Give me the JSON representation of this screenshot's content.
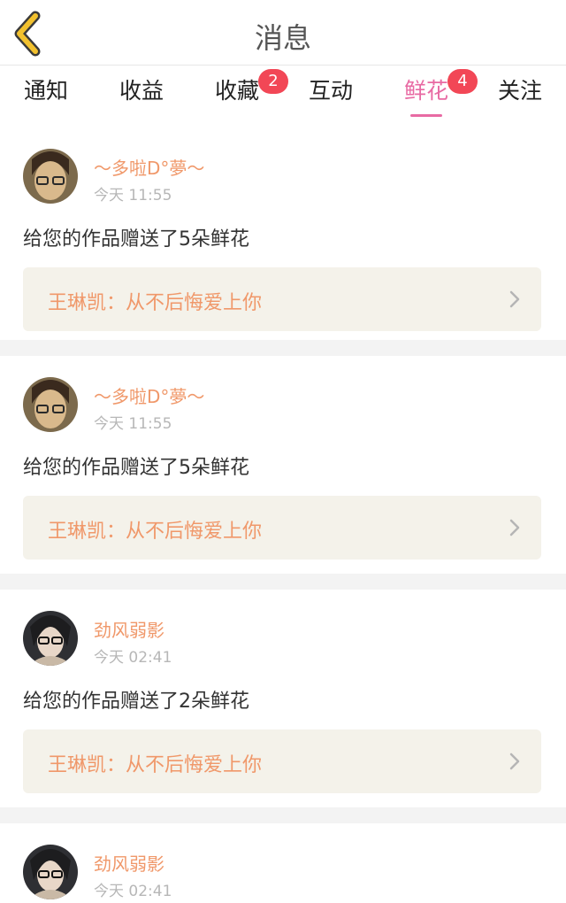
{
  "header": {
    "title": "消息"
  },
  "tabs": [
    {
      "label": "通知",
      "badge": ""
    },
    {
      "label": "收益",
      "badge": ""
    },
    {
      "label": "收藏",
      "badge": "2"
    },
    {
      "label": "互动",
      "badge": ""
    },
    {
      "label": "鲜花",
      "badge": "4"
    },
    {
      "label": "关注",
      "badge": ""
    }
  ],
  "active_tab": "鲜花",
  "messages": [
    {
      "user": "～多啦D°夢～",
      "time": "今天 11:55",
      "text": "给您的作品赠送了5朵鲜花",
      "song": "王琳凯：从不后悔爱上你"
    },
    {
      "user": "～多啦D°夢～",
      "time": "今天 11:55",
      "text": "给您的作品赠送了5朵鲜花",
      "song": "王琳凯：从不后悔爱上你"
    },
    {
      "user": "劲风弱影",
      "time": "今天 02:41",
      "text": "给您的作品赠送了2朵鲜花",
      "song": "王琳凯：从不后悔爱上你"
    },
    {
      "user": "劲风弱影",
      "time": "今天 02:41",
      "text": "",
      "song": ""
    }
  ],
  "colors": {
    "accent": "#e86aa3",
    "badge": "#f24756",
    "username": "#f0986a",
    "back_icon": "#f2c12e",
    "link_bg": "#f4f2ea"
  },
  "icons": {
    "back": "back-chevron-icon",
    "forward": "chevron-right-icon"
  }
}
